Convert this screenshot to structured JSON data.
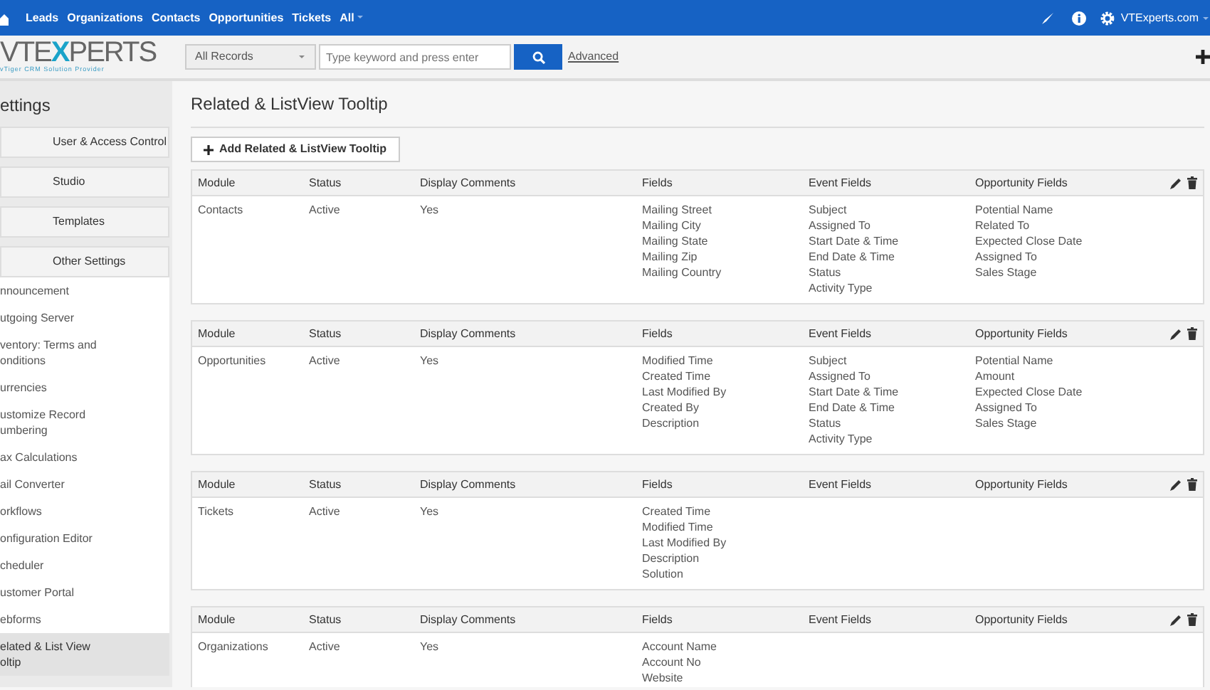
{
  "top_nav": {
    "items": [
      "Leads",
      "Organizations",
      "Contacts",
      "Opportunities",
      "Tickets",
      "All"
    ],
    "user": "VTExperts.com"
  },
  "header": {
    "logo": {
      "left": "VTE",
      "accent": "X",
      "right": "PERTS",
      "tagline": "vTiger CRM Solution Provider"
    },
    "record_select": "All Records",
    "search": {
      "placeholder": "Type keyword and press enter"
    },
    "advanced": "Advanced"
  },
  "sidebar": {
    "title": "ettings",
    "groups": [
      {
        "label": "User & Access Control"
      },
      {
        "label": "Studio"
      },
      {
        "label": "Templates"
      },
      {
        "label": "Other Settings",
        "items": [
          {
            "label": "nnouncement",
            "selected": false
          },
          {
            "label": "utgoing Server",
            "selected": false
          },
          {
            "label": "ventory: Terms and onditions",
            "selected": false
          },
          {
            "label": "urrencies",
            "selected": false
          },
          {
            "label": "ustomize Record umbering",
            "selected": false
          },
          {
            "label": "ax Calculations",
            "selected": false
          },
          {
            "label": "ail Converter",
            "selected": false
          },
          {
            "label": "orkflows",
            "selected": false
          },
          {
            "label": "onfiguration Editor",
            "selected": false
          },
          {
            "label": "cheduler",
            "selected": false
          },
          {
            "label": "ustomer Portal",
            "selected": false
          },
          {
            "label": "ebforms",
            "selected": false
          },
          {
            "label": "elated & List View oltip",
            "selected": true
          }
        ]
      }
    ]
  },
  "page": {
    "title": "Related & ListView Tooltip",
    "add_button": "Add Related & ListView Tooltip",
    "blocks": [
      {
        "columns": [
          "Module",
          "Status",
          "Display Comments",
          "Fields",
          "Event Fields",
          "Opportunity Fields"
        ],
        "module": "Contacts",
        "status": "Active",
        "display_comments": "Yes",
        "fields": [
          "Mailing Street",
          "Mailing City",
          "Mailing State",
          "Mailing Zip",
          "Mailing Country"
        ],
        "event_fields": [
          "Subject",
          "Assigned To",
          "Start Date & Time",
          "End Date & Time",
          "Status",
          "Activity Type"
        ],
        "opportunity_fields": [
          "Potential Name",
          "Related To",
          "Expected Close Date",
          "Assigned To",
          "Sales Stage"
        ]
      },
      {
        "columns": [
          "Module",
          "Status",
          "Display Comments",
          "Fields",
          "Event Fields",
          "Opportunity Fields"
        ],
        "module": "Opportunities",
        "status": "Active",
        "display_comments": "Yes",
        "fields": [
          "Modified Time",
          "Created Time",
          "Last Modified By",
          "Created By",
          "Description"
        ],
        "event_fields": [
          "Subject",
          "Assigned To",
          "Start Date & Time",
          "End Date & Time",
          "Status",
          "Activity Type"
        ],
        "opportunity_fields": [
          "Potential Name",
          "Amount",
          "Expected Close Date",
          "Assigned To",
          "Sales Stage"
        ]
      },
      {
        "columns": [
          "Module",
          "Status",
          "Display Comments",
          "Fields",
          "Event Fields",
          "Opportunity Fields"
        ],
        "module": "Tickets",
        "status": "Active",
        "display_comments": "Yes",
        "fields": [
          "Created Time",
          "Modified Time",
          "Last Modified By",
          "Description",
          "Solution"
        ]
      },
      {
        "columns": [
          "Module",
          "Status",
          "Display Comments",
          "Fields",
          "Event Fields",
          "Opportunity Fields"
        ],
        "module": "Organizations",
        "status": "Active",
        "display_comments": "Yes",
        "fields": [
          "Account Name",
          "Account No",
          "Website"
        ]
      }
    ]
  }
}
